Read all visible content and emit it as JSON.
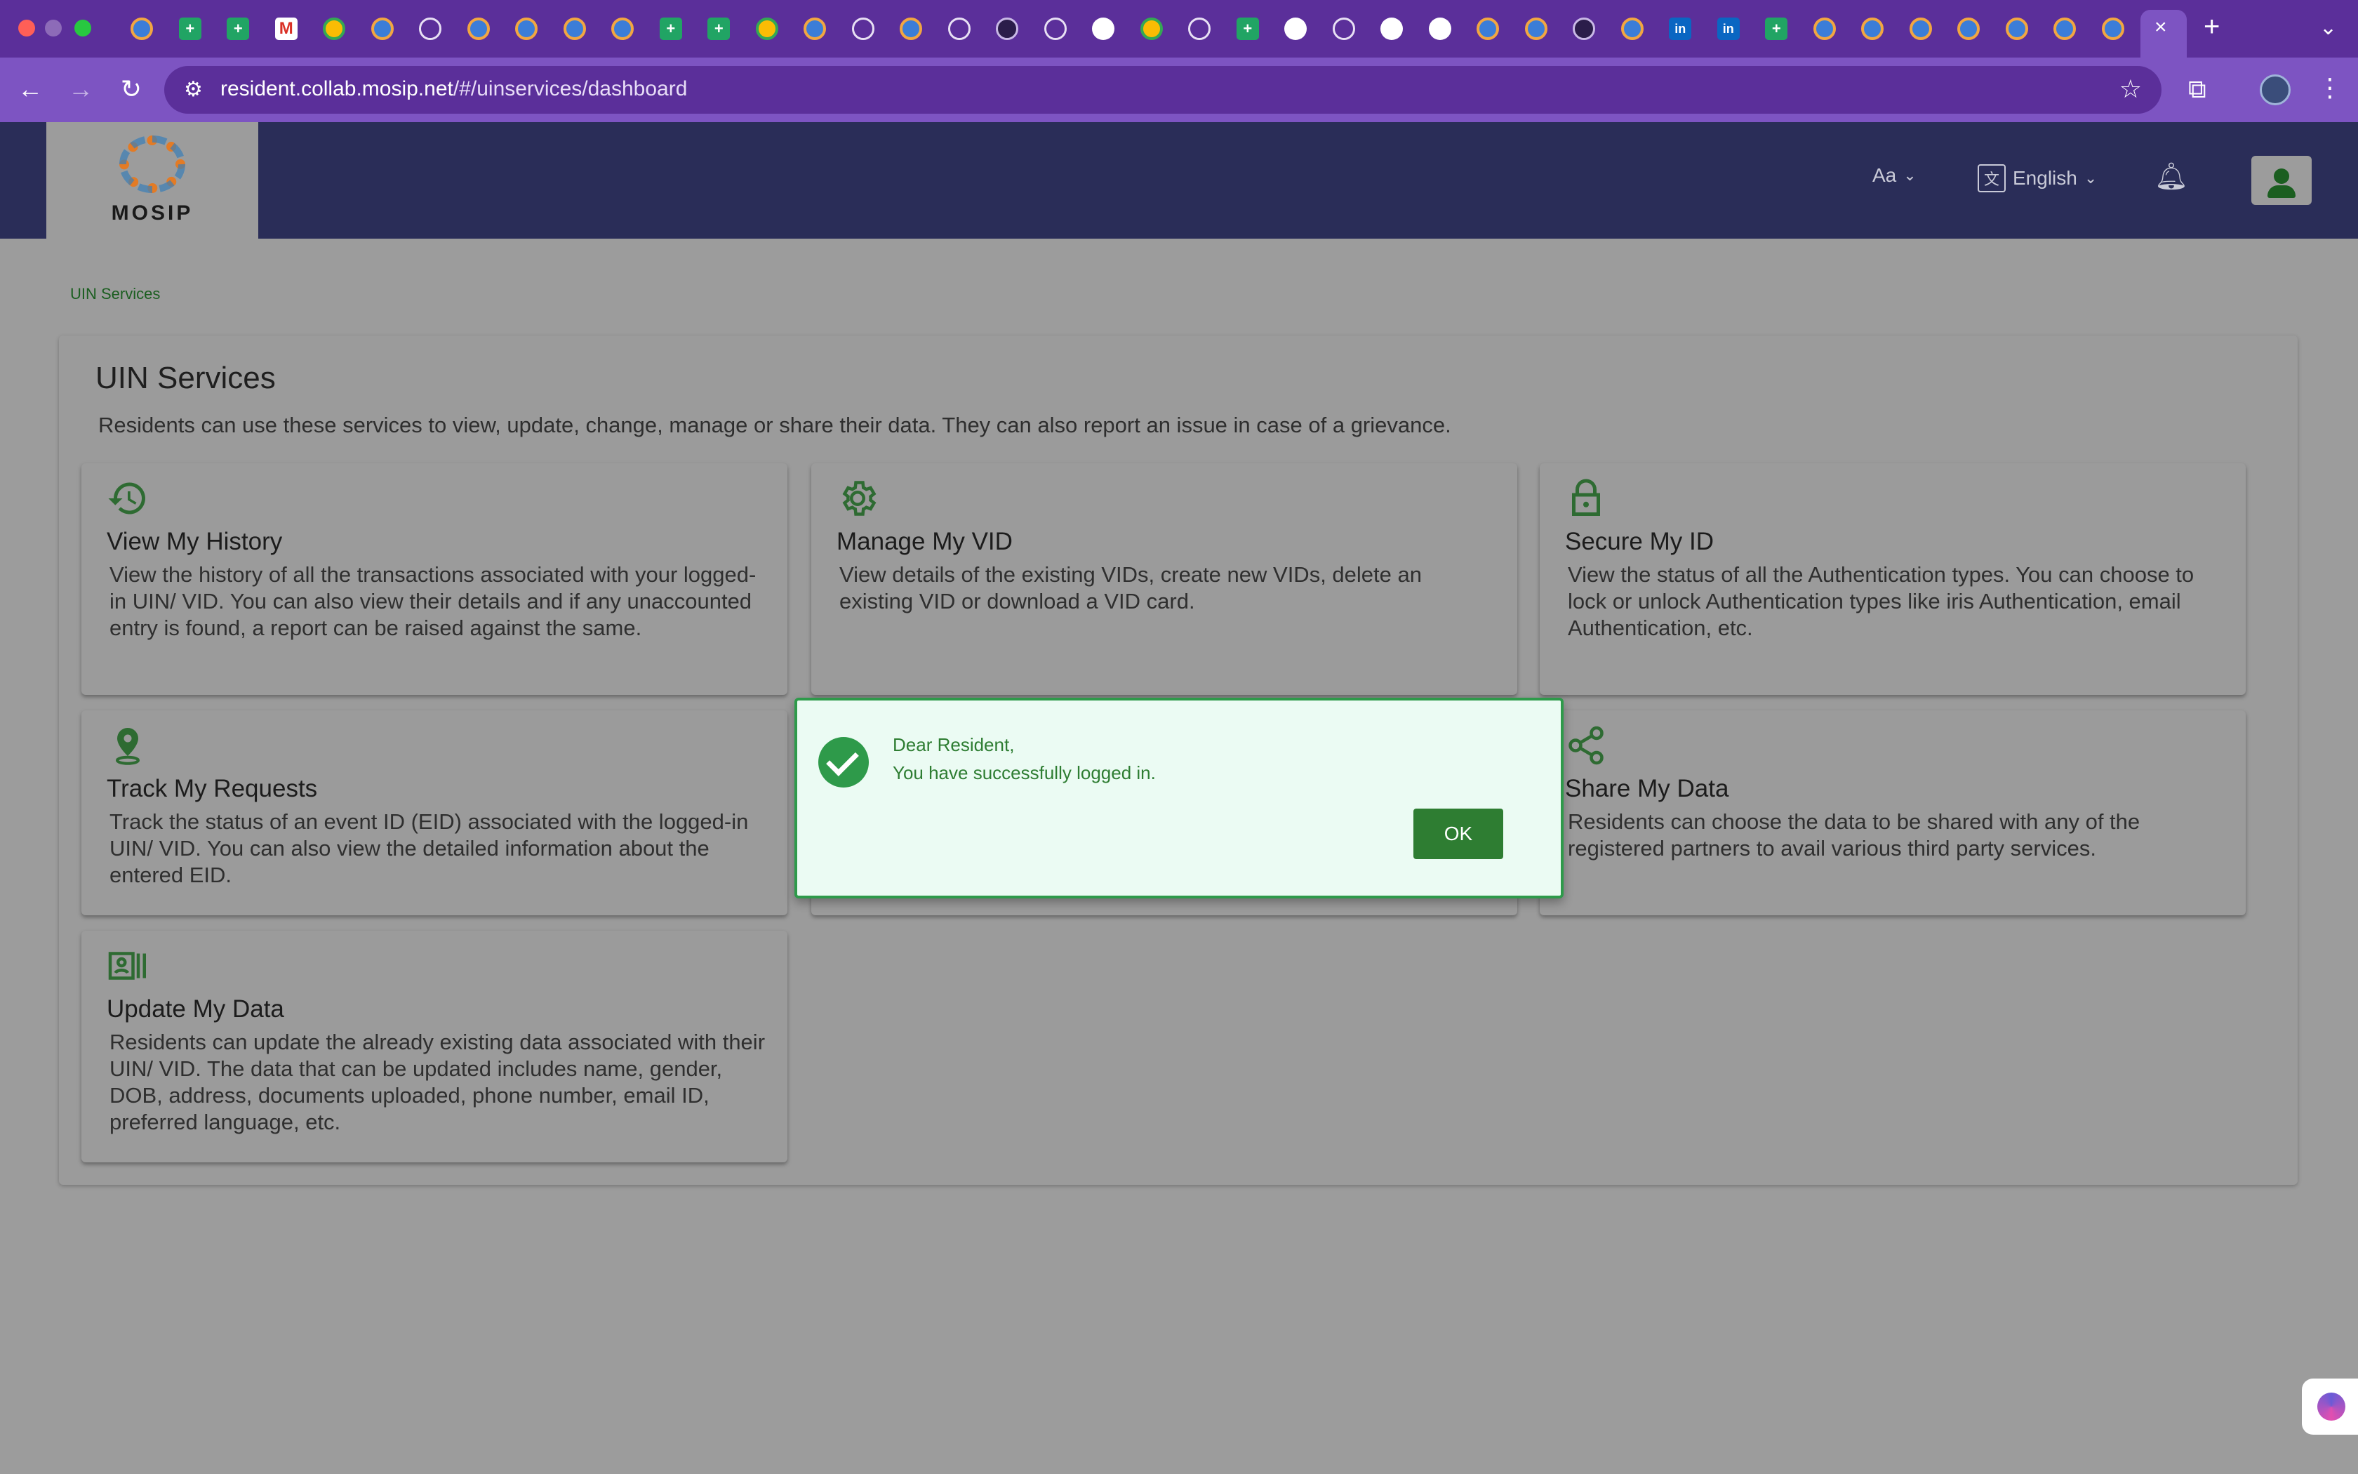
{
  "browser": {
    "tabs_count": 42,
    "active_tab_close": "×",
    "new_tab": "+",
    "url_host": "resident.collab.mosip.net",
    "url_path": "/#/uinservices/dashboard"
  },
  "header": {
    "logo_text": "MOSIP",
    "font_size_label": "Aa",
    "language_label": "English"
  },
  "breadcrumb": "UIN Services",
  "panel": {
    "title": "UIN Services",
    "description": "Residents can use these services to view, update, change, manage or share their data. They can also report an issue in case of a grievance."
  },
  "cards": [
    {
      "title": "View My History",
      "icon": "history-icon",
      "description": "View the history of all the transactions associated with your logged-in UIN/ VID. You can also view their details and if any unaccounted entry is found, a report can be raised against the same."
    },
    {
      "title": "Manage My VID",
      "icon": "gear-icon",
      "description": "View details of the existing VIDs, create new VIDs, delete an existing VID or download a VID card."
    },
    {
      "title": "Secure My ID",
      "icon": "lock-icon",
      "description": "View the status of all the Authentication types. You can choose to lock or unlock Authentication types like iris Authentication, email Authentication, etc."
    },
    {
      "title": "Track My Requests",
      "icon": "location-pin-icon",
      "description": "Track the status of an event ID (EID) associated with the logged-in UIN/ VID. You can also view the detailed information about the entered EID."
    },
    {
      "title": "Share My Data",
      "icon": "share-icon",
      "description": "Residents can choose the data to be shared with any of the registered partners to avail various third party services."
    },
    {
      "title": "Update My Data",
      "icon": "id-card-icon",
      "description": "Residents can update the already existing data associated with their UIN/ VID. The data that can be updated includes name, gender, DOB, address, documents uploaded, phone number, email ID, preferred language, etc."
    }
  ],
  "dialog": {
    "line1": "Dear Resident,",
    "line2": "You have successfully logged in.",
    "ok_label": "OK",
    "accent": "#2e7d32"
  }
}
